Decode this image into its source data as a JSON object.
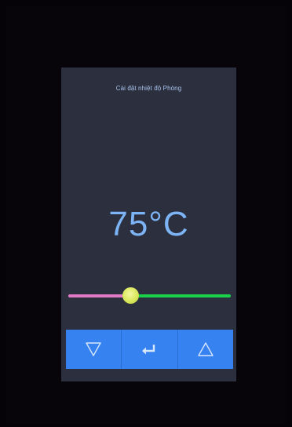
{
  "screen": {
    "title": "Cài đặt nhiệt độ Phòng",
    "temperature_display": "75°C",
    "background_color": "#2c2f3d",
    "text_color": "#7cb4f5"
  },
  "slider": {
    "value_fraction": 0.38,
    "active_color": "#e07ac6",
    "inactive_color": "#19d24a",
    "thumb_color": "#d9e85c"
  },
  "buttons": [
    {
      "icon": "triangle-down-icon",
      "action": "decrease"
    },
    {
      "icon": "enter-icon",
      "action": "confirm"
    },
    {
      "icon": "triangle-up-icon",
      "action": "increase"
    }
  ],
  "button_color": "#3582f0"
}
